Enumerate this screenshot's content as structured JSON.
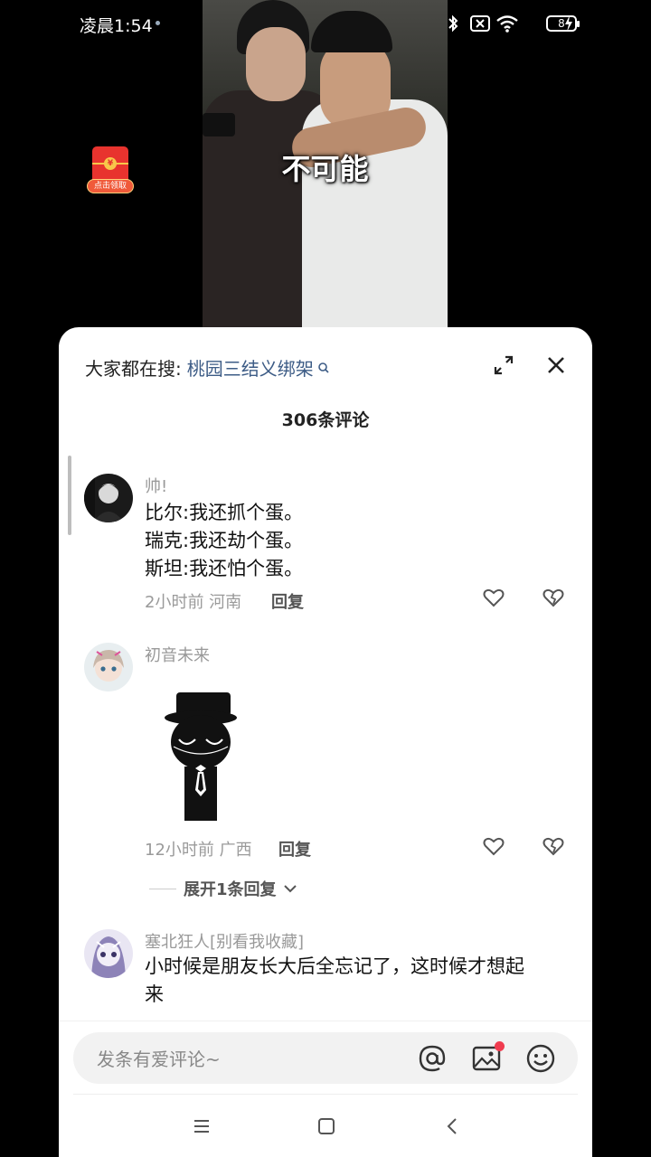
{
  "status_bar": {
    "time": "凌晨1:54",
    "battery": "8",
    "icons": [
      "bluetooth-icon",
      "sim-x-icon",
      "wifi-icon",
      "battery-icon",
      "charging-icon"
    ]
  },
  "video": {
    "caption": "不可能"
  },
  "red_packet": {
    "label": "点击领取",
    "coin": "¥"
  },
  "comments_panel": {
    "search_prefix": "大家都在搜:",
    "search_term": "桃园三结义绑架",
    "count_title": "306条评论",
    "comments": [
      {
        "username": "帅!",
        "lines": [
          "比尔:我还抓个蛋。",
          "瑞克:我还劫个蛋。",
          "斯坦:我还怕个蛋。"
        ],
        "meta": "2小时前 河南",
        "reply": "回复"
      },
      {
        "username": "初音未来",
        "meta": "12小时前 广西",
        "reply": "回复",
        "expand_replies": "展开1条回复"
      },
      {
        "username": "塞北狂人[别看我收藏]",
        "lines": [
          "小时候是朋友长大后全忘记了，这时候才想起",
          "来"
        ]
      }
    ]
  },
  "input_bar": {
    "placeholder": "发条有爱评论~"
  },
  "colors": {
    "search_link": "#3d5c86",
    "red_dot": "#f03c4f",
    "red_packet": "#e8332e"
  }
}
